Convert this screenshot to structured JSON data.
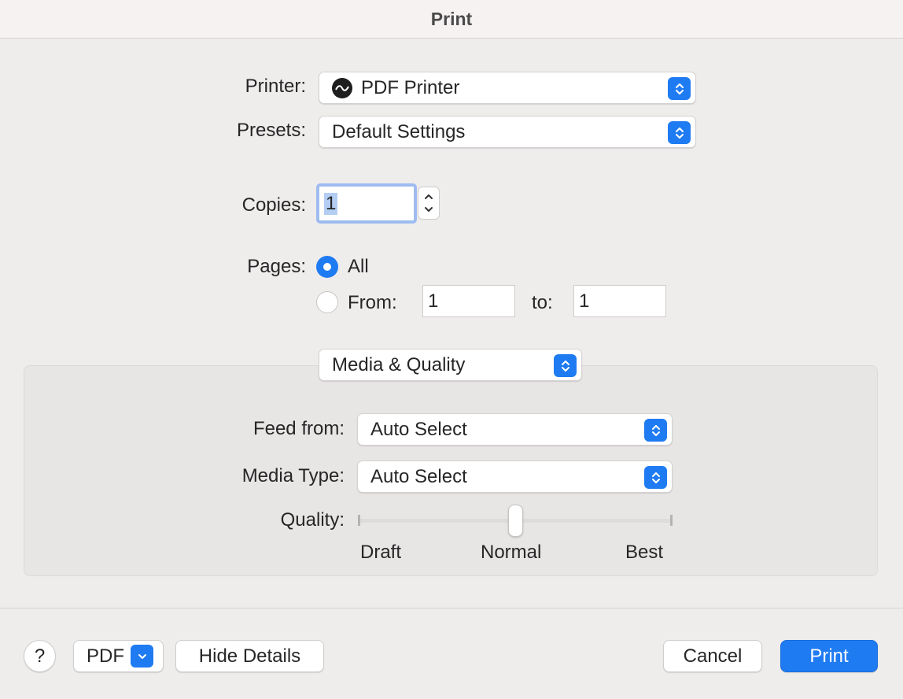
{
  "window": {
    "title": "Print"
  },
  "printer": {
    "label": "Printer:",
    "value": "PDF Printer"
  },
  "presets": {
    "label": "Presets:",
    "value": "Default Settings"
  },
  "copies": {
    "label": "Copies:",
    "value": "1"
  },
  "pages": {
    "label": "Pages:",
    "all_label": "All",
    "from_label": "From:",
    "from_value": "1",
    "to_label": "to:",
    "to_value": "1",
    "selected": "All"
  },
  "section": {
    "value": "Media & Quality"
  },
  "feed_from": {
    "label": "Feed from:",
    "value": "Auto Select"
  },
  "media_type": {
    "label": "Media Type:",
    "value": "Auto Select"
  },
  "quality": {
    "label": "Quality:",
    "min_label": "Draft",
    "mid_label": "Normal",
    "max_label": "Best",
    "level": 0.5
  },
  "footer": {
    "help_label": "?",
    "pdf_label": "PDF",
    "hide_details_label": "Hide Details",
    "cancel_label": "Cancel",
    "print_label": "Print"
  },
  "colors": {
    "accent": "#1f7bf2",
    "background": "#efecec"
  },
  "icons": {
    "printer": "pdf-printer-icon",
    "popup": "up-down-chevron-icon"
  }
}
